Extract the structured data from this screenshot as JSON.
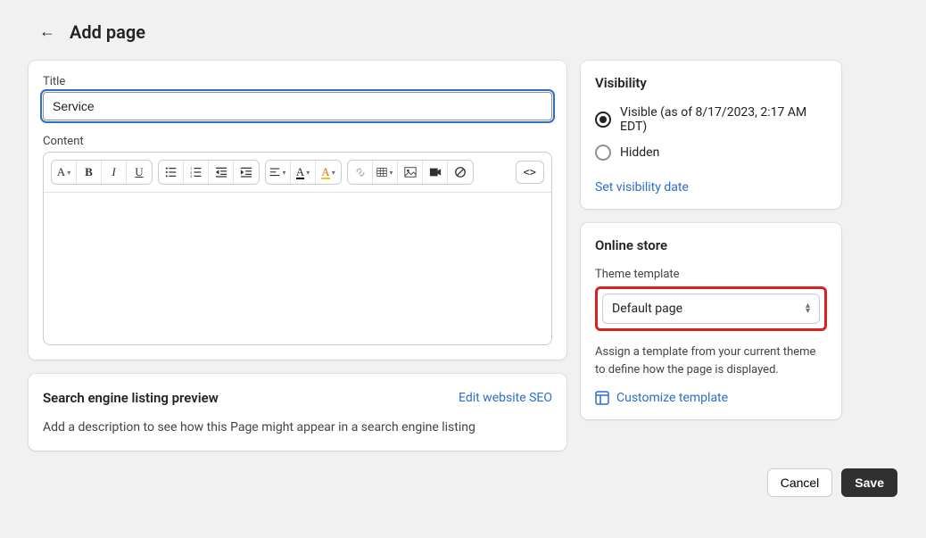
{
  "header": {
    "title": "Add page"
  },
  "main": {
    "title_label": "Title",
    "title_value": "Service",
    "content_label": "Content",
    "toolbar": {
      "para": "A",
      "bold": "B",
      "italic": "I",
      "underline": "U",
      "colorA": "A",
      "colorA2": "A"
    },
    "code_button": "<>"
  },
  "seo": {
    "heading": "Search engine listing preview",
    "edit_link": "Edit website SEO",
    "description": "Add a description to see how this Page might appear in a search engine listing"
  },
  "visibility": {
    "heading": "Visibility",
    "visible_label": "Visible (as of 8/17/2023, 2:17 AM EDT)",
    "hidden_label": "Hidden",
    "set_date_link": "Set visibility date"
  },
  "online_store": {
    "heading": "Online store",
    "template_label": "Theme template",
    "selected": "Default page",
    "helper": "Assign a template from your current theme to define how the page is displayed.",
    "customize_link": "Customize template"
  },
  "footer": {
    "cancel": "Cancel",
    "save": "Save"
  }
}
